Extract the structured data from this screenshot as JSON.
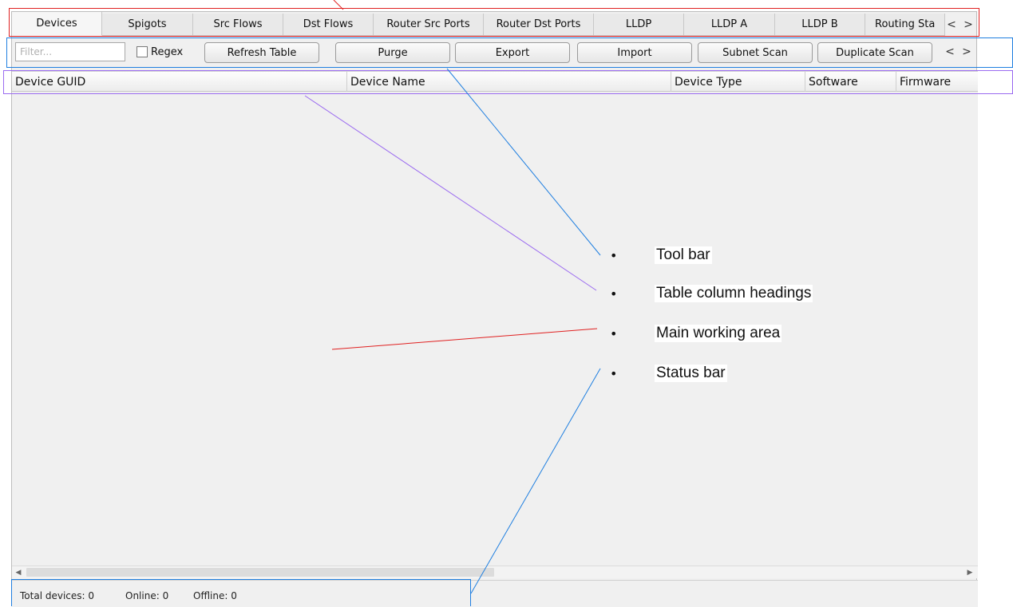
{
  "tabs": [
    {
      "label": "Devices",
      "active": true
    },
    {
      "label": "Spigots"
    },
    {
      "label": "Src Flows"
    },
    {
      "label": "Dst Flows"
    },
    {
      "label": "Router Src Ports"
    },
    {
      "label": "Router Dst Ports"
    },
    {
      "label": "LLDP"
    },
    {
      "label": "LLDP A"
    },
    {
      "label": "LLDP B"
    },
    {
      "label": "Routing Sta"
    }
  ],
  "tab_nav": {
    "prev": "<",
    "next": ">"
  },
  "toolbar": {
    "filter_placeholder": "Filter...",
    "regex_label": "Regex",
    "regex_checked": false,
    "buttons": [
      "Refresh Table",
      "Purge",
      "Export",
      "Import",
      "Subnet Scan",
      "Duplicate Scan"
    ],
    "nav_prev": "<",
    "nav_next": ">"
  },
  "columns": [
    "Device GUID",
    "Device Name",
    "Device Type",
    "Software",
    "Firmware"
  ],
  "status": {
    "total": "Total devices: 0",
    "online": "Online: 0",
    "offline": "Offline: 0"
  },
  "annotations": {
    "bullet": "•",
    "items": [
      "Tool bar",
      "Table column headings",
      "Main working area",
      "Status bar"
    ],
    "colors": {
      "tabs": "#e02020",
      "toolbar": "#1f7fe0",
      "headings": "#9b6bf0",
      "status": "#1f7fe0"
    }
  }
}
